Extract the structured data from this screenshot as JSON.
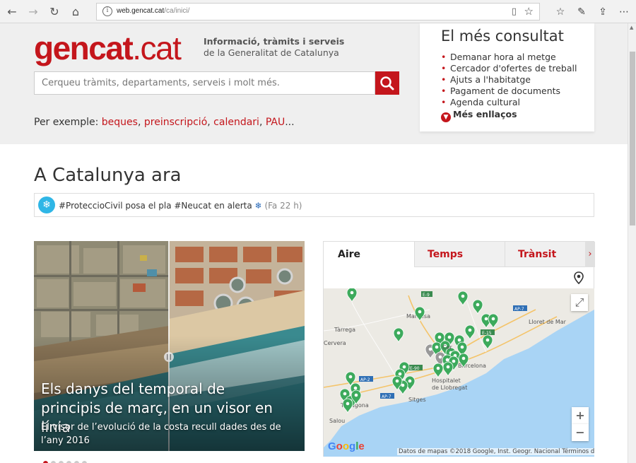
{
  "browser": {
    "url_host": "web.gencat.cat",
    "url_path": "/ca/inici/"
  },
  "header": {
    "logo_main": "gencat",
    "logo_dot": ".cat",
    "tagline_1": "Informació, tràmits i serveis",
    "tagline_2": "de la Generalitat de Catalunya"
  },
  "search": {
    "placeholder": "Cerqueu tràmits, departaments, serveis i molt més."
  },
  "examples": {
    "prefix": "Per exemple: ",
    "items": [
      "beques",
      "preinscripció",
      "calendari",
      "PAU"
    ],
    "ellipsis": "..."
  },
  "consultat": {
    "title": "El més consultat",
    "items": [
      "Demanar hora al metge",
      "Cercador d'ofertes de treball",
      "Ajuts a l'habitatge",
      "Pagament de documents",
      "Agenda cultural"
    ],
    "more_label": "Més enllaços"
  },
  "catalunya_ara": {
    "title": "A Catalunya ara",
    "alert_text": "#ProteccioCivil posa el pla #Neucat en alerta",
    "alert_emoji": "❄",
    "alert_time": "(Fa 22 h)"
  },
  "carousel": {
    "title": "Els danys del temporal de principis de març, en un visor en línia",
    "subtitle": "El visor de l’evolució de la costa recull dades des de l’any 2016",
    "slide_count": 7,
    "active_slide": 1
  },
  "tabs": {
    "items": [
      "Aire",
      "Temps",
      "Trànsit"
    ],
    "next": "›"
  },
  "map": {
    "labels": [
      "Manresa",
      "Tàrrega",
      "Lloret de Mar",
      "Hospitalet de Llobregat",
      "Sitges",
      "Salou",
      "Tarragona",
      "Barcelona",
      "Cervera"
    ],
    "roads": [
      "E-9",
      "AP-7",
      "E-90",
      "AP-2",
      "AP-7",
      "E-15"
    ],
    "google": "Google",
    "attribution": "Datos de mapas ©2018 Google, Inst. Geogr. Nacional   Términos de uso"
  },
  "colors": {
    "brand_red": "#c4161c",
    "sea": "#a9d4f5",
    "land": "#eceae4",
    "marker_green": "#3daa5c",
    "marker_grey": "#999999"
  }
}
